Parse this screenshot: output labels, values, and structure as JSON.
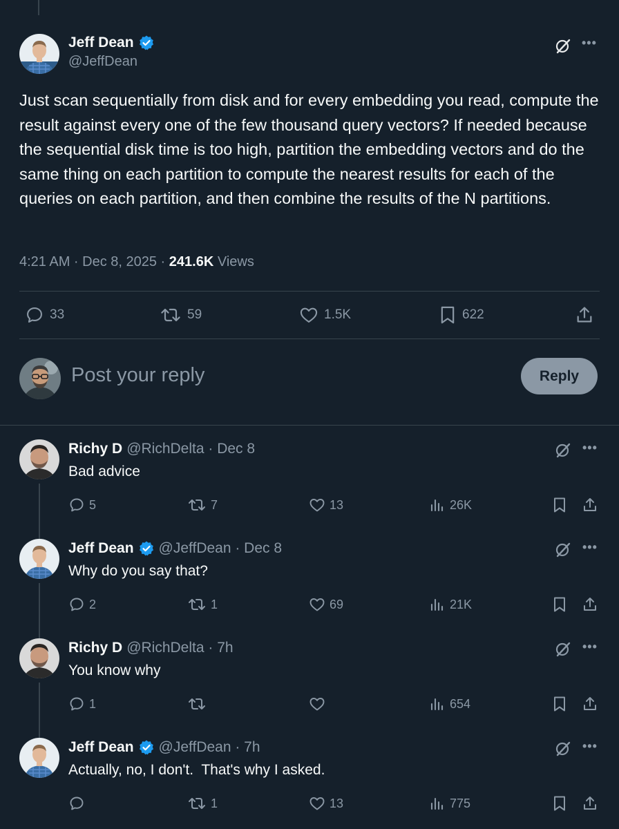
{
  "main_tweet": {
    "author_name": "Jeff Dean",
    "handle": "@JeffDean",
    "text": "Just scan sequentially from disk and for every embedding you read, compute the result against every one of the few thousand query vectors? If needed because the sequential disk time is too high, partition the embedding vectors and do the same thing on each partition to compute the nearest results for each of the queries on each partition, and then combine the results of the N partitions.",
    "time": "4:21 AM · Dec 8, 2025 · ",
    "views_count": "241.6K",
    "views_label": " Views",
    "replies": "33",
    "reposts": "59",
    "likes": "1.5K",
    "bookmarks": "622"
  },
  "composer": {
    "placeholder": "Post your reply",
    "reply_button": "Reply"
  },
  "replies": [
    {
      "name": "Richy D",
      "handle_time": "@RichDelta · Dec 8",
      "text": "Bad advice",
      "replies": "5",
      "reposts": "7",
      "likes": "13",
      "views": "26K",
      "verified": false
    },
    {
      "name": "Jeff Dean",
      "handle_time": "@JeffDean · Dec 8",
      "text": "Why do you say that?",
      "replies": "2",
      "reposts": "1",
      "likes": "69",
      "views": "21K",
      "verified": true
    },
    {
      "name": "Richy D",
      "handle_time": "@RichDelta · 7h",
      "text": "You know why",
      "replies": "1",
      "reposts": "",
      "likes": "",
      "views": "654",
      "verified": false
    },
    {
      "name": "Jeff Dean",
      "handle_time": "@JeffDean · 7h",
      "text": "Actually, no, I don't.  That's why I asked.",
      "replies": "",
      "reposts": "1",
      "likes": "13",
      "views": "775",
      "verified": true
    }
  ],
  "colors": {
    "background": "#15202b",
    "text": "#f7f9f9",
    "muted": "#8b98a5",
    "verified": "#1d9bf0",
    "divider": "#38444d"
  },
  "icons": [
    "verified-icon",
    "grok-icon",
    "more-icon",
    "reply-icon",
    "repost-icon",
    "like-icon",
    "views-icon",
    "bookmark-icon",
    "share-icon"
  ]
}
